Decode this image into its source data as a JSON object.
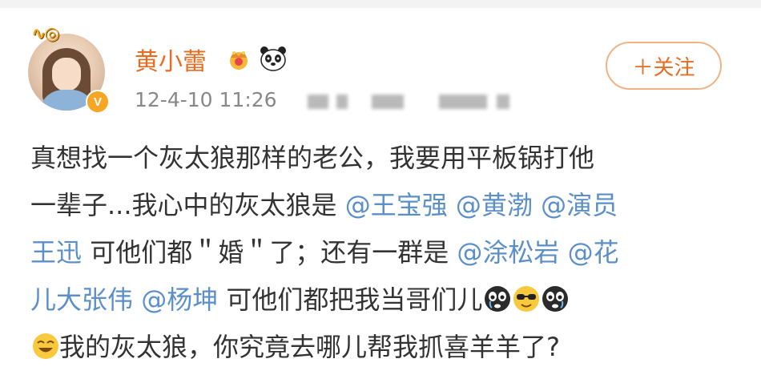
{
  "post": {
    "username": "黄小蕾",
    "timestamp": "12-4-10 11:26",
    "follow_label": "＋关注",
    "line1": "真想找一个灰太狼那样的老公，我要用平板锅打他",
    "line2_text": "一辈子...我心中的灰太狼是 ",
    "mention1": "@王宝强",
    "mention2": "@黄渤",
    "mention3_part1": "@演员",
    "mention3_part2": "王迅",
    "line3_text": " 可他们都＂婚＂了；还有一群是 ",
    "mention4": "@涂松岩",
    "mention5_part1": "@花",
    "mention5_part2": "儿大张伟",
    "mention6": "@杨坤",
    "line4_text": " 可他们都把我当哥们儿",
    "line5_text": "我的灰太狼，你究竟去哪儿帮我抓喜羊羊了?"
  },
  "icons": {
    "crown": "crown-icon",
    "panda": "panda-icon",
    "verified": "verified-badge-icon",
    "emoji1": "crying-face-emoji",
    "emoji2": "sunglasses-face-emoji",
    "emoji3": "crying-face-emoji",
    "emoji4": "grinning-face-emoji"
  },
  "colors": {
    "username": "#e86b1f",
    "mention": "#5b8fc9",
    "text": "#333333",
    "timestamp": "#888888",
    "verified_badge": "#f5a623"
  }
}
